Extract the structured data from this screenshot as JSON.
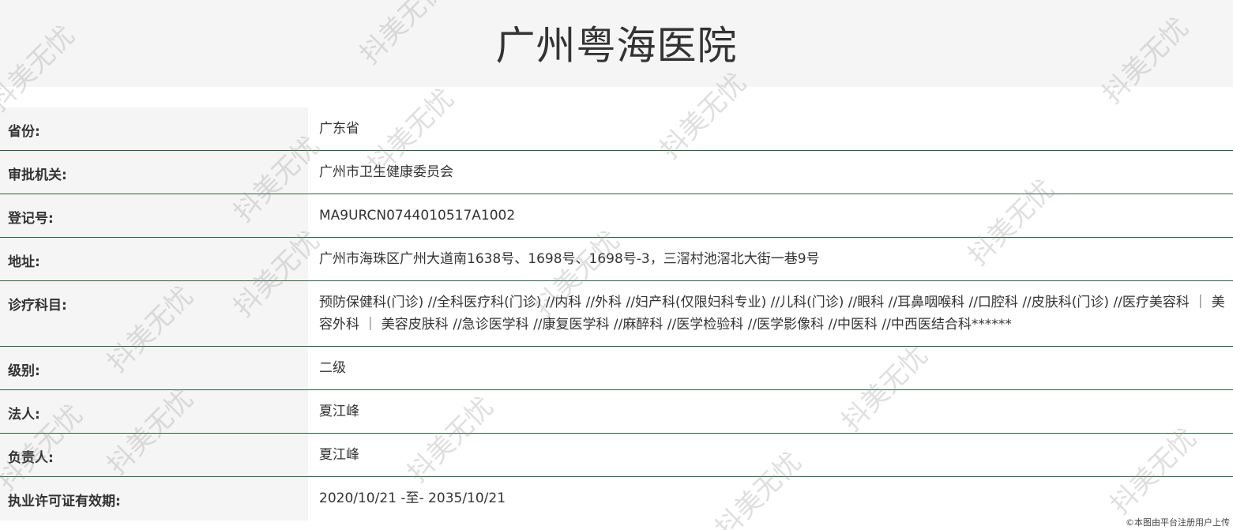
{
  "title": "广州粤海医院",
  "rows": [
    {
      "label": "省份:",
      "value": "广东省"
    },
    {
      "label": "审批机关:",
      "value": "广州市卫生健康委员会"
    },
    {
      "label": "登记号:",
      "value": "MA9URCN0744010517A1002"
    },
    {
      "label": "地址:",
      "value": "广州市海珠区广州大道南1638号、1698号、1698号-3，三滘村池滘北大街一巷9号"
    },
    {
      "label": "诊疗科目:",
      "value": "预防保健科(门诊) //全科医疗科(门诊) //内科 //外科 //妇产科(仅限妇科专业) //儿科(门诊) //眼科 //耳鼻咽喉科 //口腔科 //皮肤科(门诊) //医疗美容科 ｜ 美容外科 ｜ 美容皮肤科 //急诊医学科 //康复医学科 //麻醉科 //医学检验科 //医学影像科 //中医科 //中西医结合科******"
    },
    {
      "label": "级别:",
      "value": "二级"
    },
    {
      "label": "法人:",
      "value": "夏江峰"
    },
    {
      "label": "负责人:",
      "value": "夏江峰"
    },
    {
      "label": "执业许可证有效期:",
      "value": "2020/10/21 -至- 2035/10/21"
    }
  ],
  "watermark_text": "抖美无忧",
  "credit": "©本图由平台注册用户上传"
}
